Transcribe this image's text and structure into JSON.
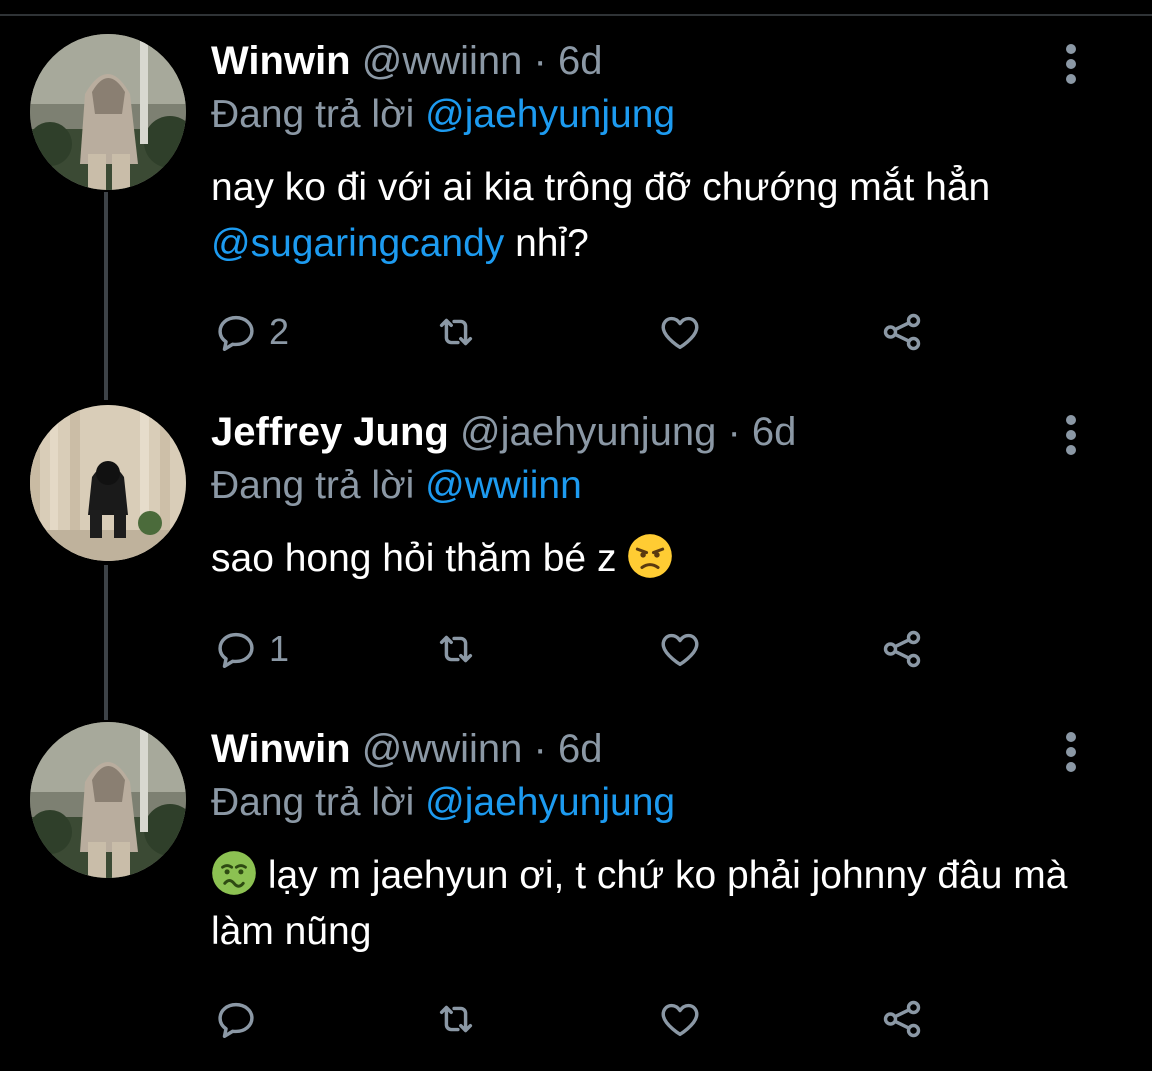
{
  "tweets": [
    {
      "display_name": "Winwin",
      "handle": "@wwiinn",
      "separator": "·",
      "time": "6d",
      "replying_prefix": "Đang trả lời",
      "replying_to": "@jaehyunjung",
      "text_part1": "nay ko đi với ai kia trông đỡ chướng mắt hẳn ",
      "text_mention": "@sugaringcandy",
      "text_part2": " nhỉ?",
      "reply_count": "2",
      "avatar_icon": "avatar-winwin-hoodie"
    },
    {
      "display_name": "Jeffrey Jung",
      "handle": "@jaehyunjung",
      "separator": "·",
      "time": "6d",
      "replying_prefix": "Đang trả lời",
      "replying_to": "@wwiinn",
      "text": "sao hong hỏi thăm bé z",
      "emoji": "angry-face-emoji",
      "reply_count": "1",
      "avatar_icon": "avatar-jeffrey-hood"
    },
    {
      "display_name": "Winwin",
      "handle": "@wwiinn",
      "separator": "·",
      "time": "6d",
      "replying_prefix": "Đang trả lời",
      "replying_to": "@jaehyunjung",
      "emoji": "nauseated-face-emoji",
      "text": "lạy m jaehyun ơi, t chứ ko phải johnny đâu mà làm nũng",
      "reply_count": "",
      "avatar_icon": "avatar-winwin-hoodie"
    }
  ],
  "icons": {
    "reply": "reply-icon",
    "retweet": "retweet-icon",
    "like": "heart-icon",
    "share": "share-icon",
    "more": "more-vertical-icon"
  },
  "colors": {
    "background": "#000000",
    "primary_text": "#ffffff",
    "secondary_text": "#8b98a5",
    "mention": "#1d9bf0",
    "thread_line": "#3d4247"
  }
}
